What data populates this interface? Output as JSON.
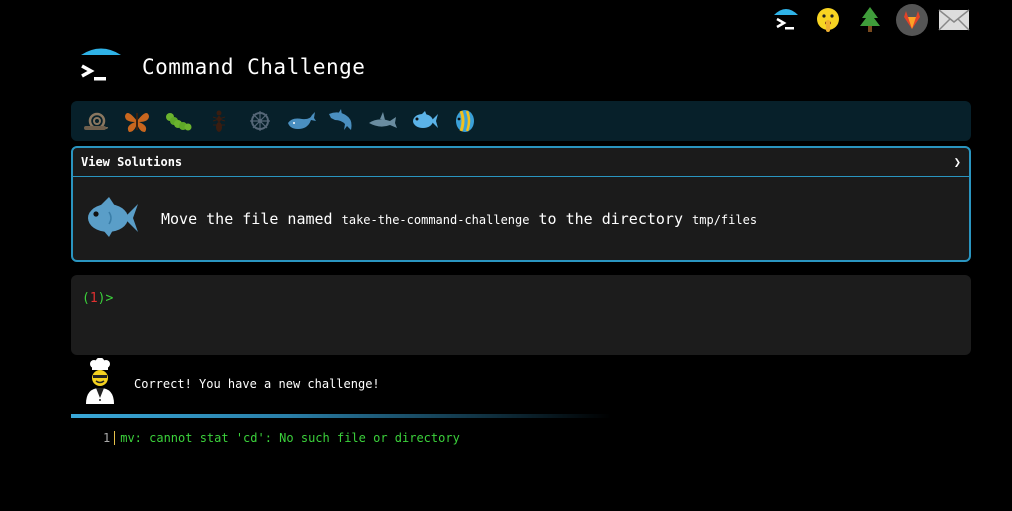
{
  "header": {
    "title": "Command Challenge"
  },
  "top_icons": [
    "terminal-logo-icon",
    "shushing-face-icon",
    "tree-icon",
    "gitlab-icon",
    "envelope-icon"
  ],
  "levels": [
    "snail-icon",
    "butterfly-icon",
    "caterpillar-icon",
    "ant-icon",
    "wheel-icon",
    "whale-icon",
    "dolphin-icon",
    "shark-icon",
    "fish-icon",
    "tropical-fish-icon"
  ],
  "challenge": {
    "view_solutions": "View Solutions",
    "toggle": "❯",
    "text_before": "Move the file named ",
    "file_name": "take-the-command-challenge",
    "text_middle": " to the directory ",
    "dir_name": "tmp/files"
  },
  "terminal": {
    "paren_open": "(",
    "number": "1",
    "paren_close": ")>"
  },
  "feedback": {
    "text": "Correct! You have a new challenge!"
  },
  "output": {
    "line_number": "1",
    "line_text": "mv: cannot stat 'cd': No such file or directory"
  },
  "colors": {
    "accent": "#2a95c0",
    "prompt_green": "#3bd13b",
    "prompt_red": "#e03030",
    "level_bar_bg": "#07202a"
  }
}
